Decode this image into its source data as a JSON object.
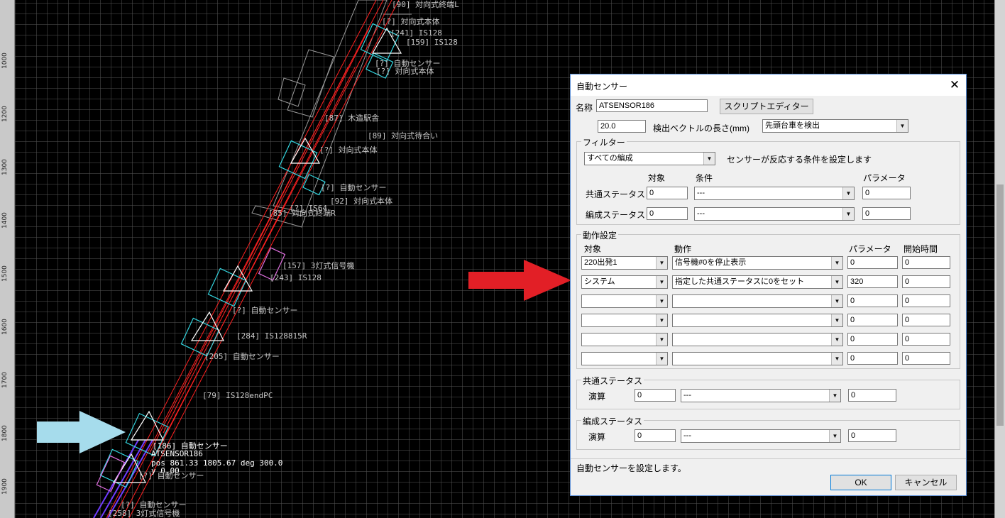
{
  "ruler": {
    "ticks": [
      "1000",
      "1200",
      "1300",
      "1400",
      "1500",
      "1600",
      "1700",
      "1800",
      "1900"
    ]
  },
  "map": {
    "labels": [
      "[90] 対向式終端L",
      "[?] 対向式本体",
      "[241] IS128",
      "[159] IS128",
      "[?] 自動センサー",
      "[?] 対向式本体",
      "[87] 木造駅舎",
      "[89] 対向式待合い",
      "[?] 対向式本体",
      "[?] 自動センサー",
      "[92] 対向式本体",
      "[85] 対向式終端R",
      "[?] IS64",
      "[157] 3灯式信号機",
      "[243] IS128",
      "[?] 自動センサー",
      "[284] IS128815R",
      "[205] 自動センサー",
      "[79] IS128endPC",
      "[186] 自動センサー",
      "ATSENSOR186",
      "pos 861.33 1805.67 deg 300.0",
      "y 0.00",
      "[?] 自動センサー",
      "[?] 自動センサー",
      "[258] 3灯式信号機"
    ]
  },
  "dialog": {
    "title": "自動センサー",
    "close_icon": "close-icon",
    "name_label": "名称",
    "name_value": "ATSENSOR186",
    "script_editor_button": "スクリプトエディター",
    "vector_length_value": "20.0",
    "vector_length_label": "検出ベクトルの長さ(mm)",
    "detect_mode": "先頭台車を検出",
    "filter": {
      "title": "フィルター",
      "formation_select": "すべての編成",
      "description": "センサーが反応する条件を設定します",
      "col_target": "対象",
      "col_condition": "条件",
      "col_parameter": "パラメータ",
      "rows": [
        {
          "label": "共通ステータス",
          "target": "0",
          "condition": "---",
          "parameter": "0"
        },
        {
          "label": "編成ステータス",
          "target": "0",
          "condition": "---",
          "parameter": "0"
        }
      ]
    },
    "action": {
      "title": "動作設定",
      "col_target": "対象",
      "col_action": "動作",
      "col_parameter": "パラメータ",
      "col_start_time": "開始時間",
      "rows": [
        {
          "target": "220出発1",
          "action": "信号機#0を停止表示",
          "parameter": "0",
          "start": "0"
        },
        {
          "target": "システム",
          "action": "指定した共通ステータスに0をセット",
          "parameter": "320",
          "start": "0"
        },
        {
          "target": "",
          "action": "",
          "parameter": "0",
          "start": "0"
        },
        {
          "target": "",
          "action": "",
          "parameter": "0",
          "start": "0"
        },
        {
          "target": "",
          "action": "",
          "parameter": "0",
          "start": "0"
        },
        {
          "target": "",
          "action": "",
          "parameter": "0",
          "start": "0"
        }
      ]
    },
    "common_status": {
      "title": "共通ステータス",
      "op_label": "演算",
      "value1": "0",
      "op": "---",
      "value2": "0"
    },
    "formation_status": {
      "title": "編成ステータス",
      "op_label": "演算",
      "value1": "0",
      "op": "---",
      "value2": "0"
    },
    "status_text": "自動センサーを設定します。",
    "ok_button": "OK",
    "cancel_button": "キャンセル"
  },
  "colors": {
    "track": "#ff2020",
    "sensor": "#33d6e0",
    "signal": "#e070e0",
    "red_arrow": "#e21f26",
    "blue_arrow": "#a6dcec",
    "dialog_border": "#5b8fd8"
  }
}
